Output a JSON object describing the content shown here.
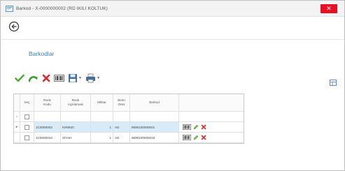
{
  "window": {
    "title": "Barkod - X-0000000002 (RD İKİLİ KOLTUK)",
    "close_label": "✕"
  },
  "page": {
    "title": "Barkodlar"
  },
  "toolbar": {
    "buttons": [
      "save-check-icon",
      "undo-icon",
      "delete-icon",
      "barcode-icon",
      "save-icon",
      "print-icon"
    ]
  },
  "grid": {
    "columns": {
      "sec": "Seç",
      "kod_line1": "Renk",
      "kod_line2": "Kodu",
      "aciklama_line1": "Renk",
      "aciklama_line2": "Açıklaması",
      "miktar": "Miktar",
      "birim_line1": "Birim",
      "birim_line2": "Ores",
      "barkod": "Barkod"
    },
    "new_row_marker": "*",
    "rows": [
      {
        "indicator": "▸",
        "renk_kodu": "1C0000003",
        "aciklama": "KIRMIZI",
        "miktar": "1",
        "birim": "AD",
        "barkod": "8690100000001"
      },
      {
        "indicator": "",
        "renk_kodu": "1C0000010",
        "aciklama": "SİYAH",
        "miktar": "1",
        "birim": "AD",
        "barkod": "8690100000018"
      }
    ]
  },
  "colors": {
    "accent": "#3c7fb0",
    "selected_row": "#d7ebf8",
    "close": "#e81123",
    "check": "#4caf3a",
    "delete": "#d9292b"
  }
}
